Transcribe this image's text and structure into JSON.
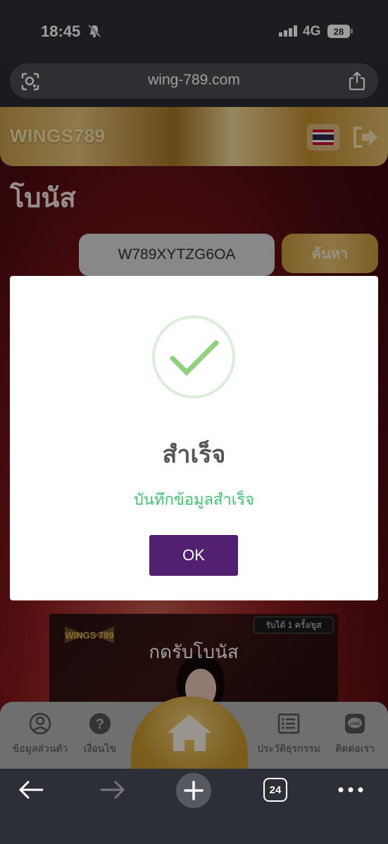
{
  "status_bar": {
    "time": "18:45",
    "network": "4G",
    "battery": "28"
  },
  "browser": {
    "url": "wing-789.com",
    "tab_count": "24"
  },
  "site": {
    "logo": "WINGS789",
    "page_title": "โบนัส"
  },
  "bonus_form": {
    "code_value": "W789XYTZG6OA",
    "search_label": "ค้นหา"
  },
  "banner": {
    "title": "กดรับโบนัส",
    "badge": "รับได้ 1 ครั้ง/ยูส",
    "logo_text": "WINGS 789"
  },
  "modal": {
    "title": "สำเร็จ",
    "message": "บันทึกข้อมูลสำเร็จ",
    "ok_label": "OK"
  },
  "bottom_nav": {
    "items": [
      {
        "label": "ข้อมูลส่วนตัว",
        "icon": "user-icon"
      },
      {
        "label": "เงื่อนไข",
        "icon": "question-icon"
      },
      {
        "label": "ประวัติธุรกรรม",
        "icon": "list-icon"
      },
      {
        "label": "ติดต่อเรา",
        "icon": "line-icon"
      }
    ],
    "home_icon": "home-icon"
  },
  "colors": {
    "accent_gold": "#d4a545",
    "ok_purple": "#53206f",
    "success_green": "#3ec56b"
  }
}
